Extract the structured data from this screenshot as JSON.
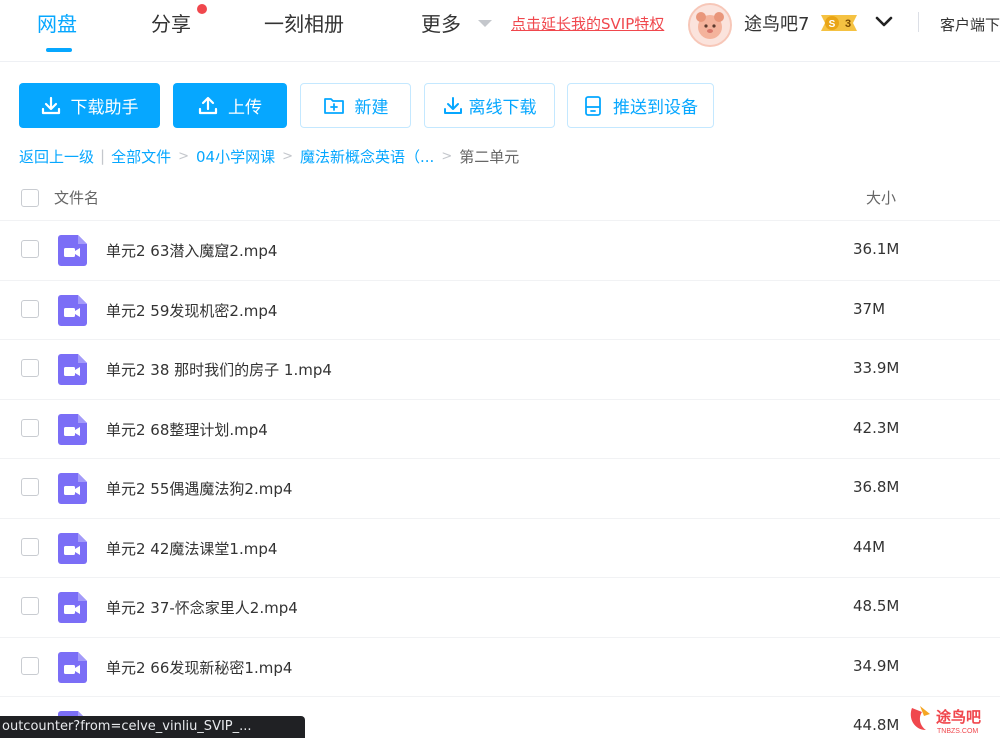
{
  "nav": {
    "tabs": [
      {
        "label": "网盘",
        "active": true
      },
      {
        "label": "分享",
        "has_dot": true
      },
      {
        "label": "一刻相册"
      },
      {
        "label": "更多"
      }
    ],
    "svip_promo": "点击延长我的SVIP特权",
    "username": "途鸟吧7",
    "vip_badge": {
      "prefix": "S",
      "level": "3"
    },
    "client_link": "客户端下"
  },
  "toolbar": {
    "download_helper": "下载助手",
    "upload": "上传",
    "new": "新建",
    "offline_download": "离线下载",
    "push_to_device": "推送到设备"
  },
  "breadcrumb": {
    "back": "返回上一级",
    "items": [
      "全部文件",
      "04小学网课",
      "魔法新概念英语（...",
      "第二单元"
    ]
  },
  "list": {
    "header": {
      "name": "文件名",
      "size": "大小"
    },
    "files": [
      {
        "name": "单元2 63潜入魔窟2.mp4",
        "size": "36.1M"
      },
      {
        "name": "单元2 59发现机密2.mp4",
        "size": "37M"
      },
      {
        "name": "单元2 38 那时我们的房子 1.mp4",
        "size": "33.9M"
      },
      {
        "name": "单元2 68整理计划.mp4",
        "size": "42.3M"
      },
      {
        "name": "单元2 55偶遇魔法狗2.mp4",
        "size": "36.8M"
      },
      {
        "name": "单元2 42魔法课堂1.mp4",
        "size": "44M"
      },
      {
        "name": "单元2 37-怀念家里人2.mp4",
        "size": "48.5M"
      },
      {
        "name": "单元2 66发现新秘密1.mp4",
        "size": "34.9M"
      },
      {
        "name": "",
        "size": "44.8M"
      }
    ]
  },
  "status_bar": "outcounter?from=celve_vinliu_SVIP_...",
  "watermark": {
    "text": "途鸟吧",
    "sub": "TNBZS.COM"
  },
  "colors": {
    "accent": "#06a7ff",
    "promo": "#f0474d",
    "video_icon": "#7b6ef6"
  }
}
